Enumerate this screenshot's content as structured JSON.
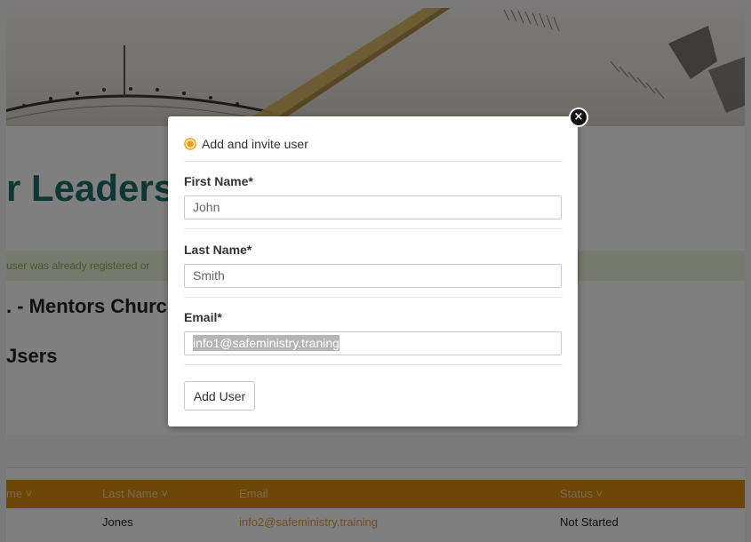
{
  "page": {
    "title": "r Leaders",
    "notice": "user was already registered or",
    "org_name": ". - Mentors Churc",
    "section_title": "Jsers"
  },
  "table": {
    "headers": [
      "me ˅",
      "Last Name ˅",
      "Email",
      "Status ˅"
    ],
    "rows": [
      [
        "",
        "Jones",
        "info2@safeministry.training",
        "Not Started"
      ]
    ]
  },
  "modal": {
    "option_label": "Add and invite user",
    "option_selected": true,
    "first_name_label": "First Name*",
    "first_name_value": "John",
    "last_name_label": "Last Name*",
    "last_name_value": "Smith",
    "email_label": "Email*",
    "email_value": "info1@safeministry.traning",
    "submit_label": "Add User",
    "close_glyph": "×"
  },
  "icons": {
    "close": "close-circle-icon",
    "radio": "radio-selected-icon",
    "sort": "chevron-down-icon"
  },
  "colors": {
    "accent": "#d98e0b",
    "title": "#1a6e6a",
    "radio": "#f29f05"
  }
}
